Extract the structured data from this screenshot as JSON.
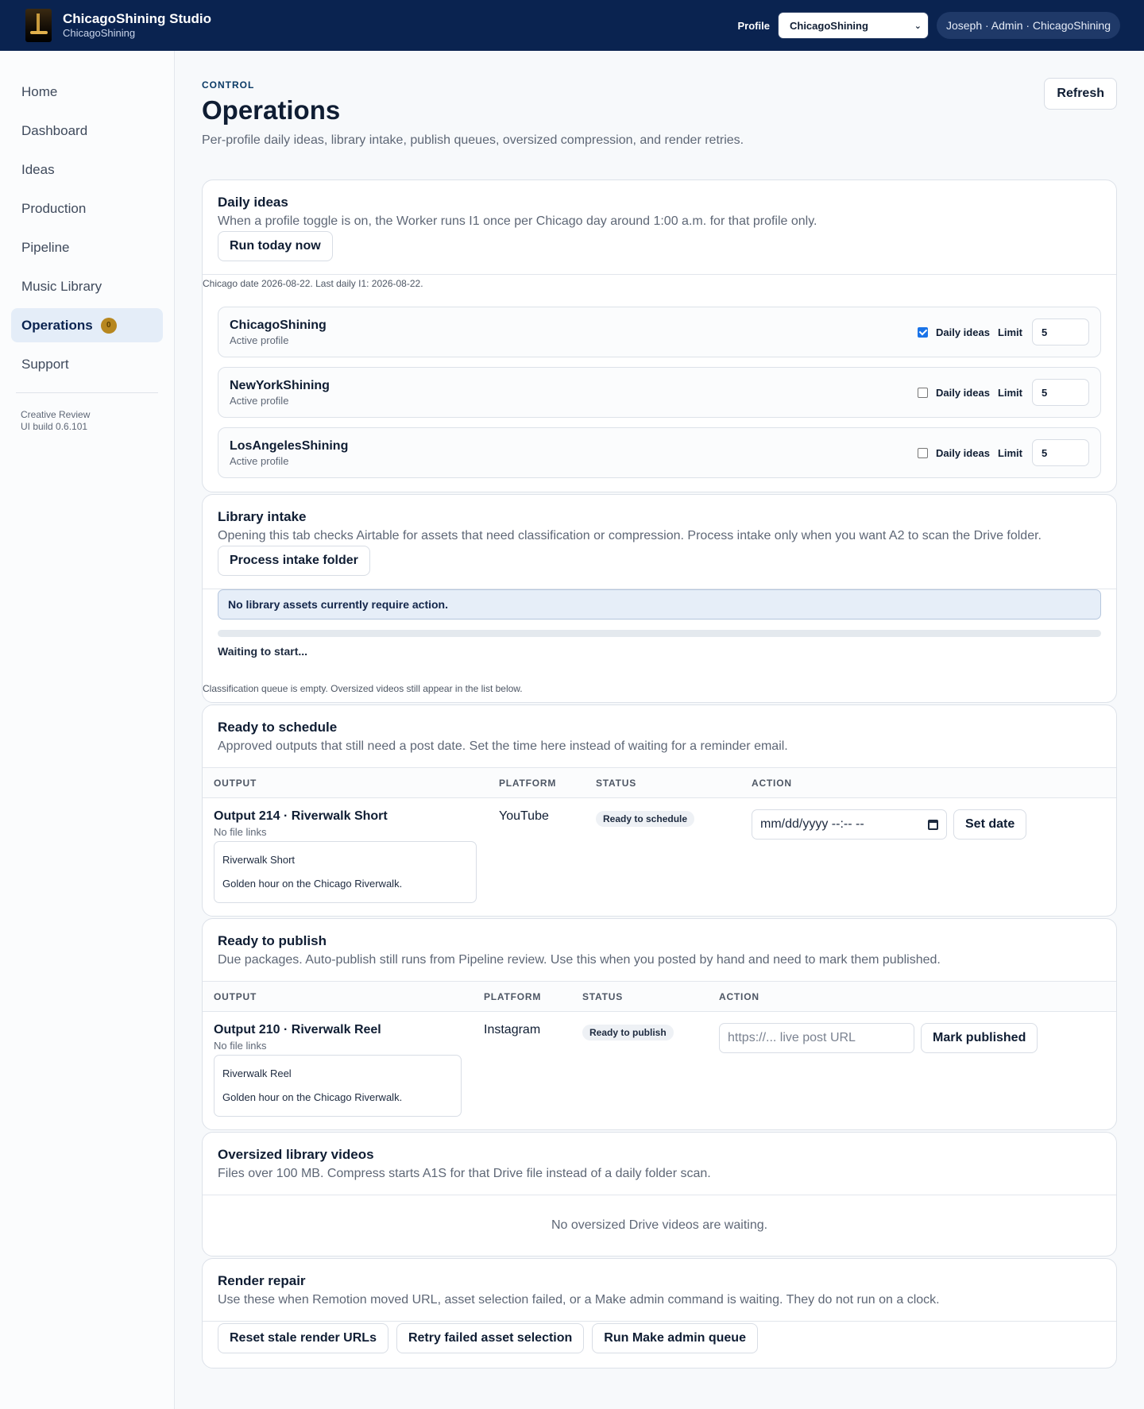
{
  "app": {
    "name": "ChicagoShining Studio",
    "sub": "ChicagoShining",
    "profile_label": "Profile",
    "profile_selected": "ChicagoShining",
    "user": "Joseph · Admin · ChicagoShining"
  },
  "sidebar": {
    "items": [
      {
        "label": "Home"
      },
      {
        "label": "Dashboard"
      },
      {
        "label": "Ideas"
      },
      {
        "label": "Production"
      },
      {
        "label": "Pipeline"
      },
      {
        "label": "Music Library"
      },
      {
        "label": "Operations",
        "badge": "0"
      },
      {
        "label": "Support"
      }
    ],
    "build_line1": "Creative Review",
    "build_line2": "UI build 0.6.101"
  },
  "page": {
    "eyebrow": "CONTROL",
    "title": "Operations",
    "desc": "Per-profile daily ideas, library intake, publish queues, oversized compression, and render retries.",
    "refresh": "Refresh"
  },
  "daily": {
    "title": "Daily ideas",
    "desc": "When a profile toggle is on, the Worker runs I1 once per Chicago day around 1:00 a.m. for that profile only.",
    "button": "Run today now",
    "note": "Chicago date 2026-08-22. Last daily I1: 2026-08-22.",
    "toggle_label": "Daily ideas",
    "limit_label": "Limit",
    "profiles": [
      {
        "name": "ChicagoShining",
        "status": "Active profile",
        "enabled": true,
        "limit": "5"
      },
      {
        "name": "NewYorkShining",
        "status": "Active profile",
        "enabled": false,
        "limit": "5"
      },
      {
        "name": "LosAngelesShining",
        "status": "Active profile",
        "enabled": false,
        "limit": "5"
      }
    ]
  },
  "intake": {
    "title": "Library intake",
    "desc": "Opening this tab checks Airtable for assets that need classification or compression. Process intake only when you want A2 to scan the Drive folder.",
    "button": "Process intake folder",
    "info": "No library assets currently require action.",
    "progress": 0,
    "progress_text": "Waiting to start...",
    "note": "Classification queue is empty. Oversized videos still appear in the list below."
  },
  "schedule": {
    "title": "Ready to schedule",
    "desc": "Approved outputs that still need a post date. Set the time here instead of waiting for a reminder email.",
    "columns": [
      "OUTPUT",
      "PLATFORM",
      "STATUS",
      "ACTION"
    ],
    "row": {
      "title": "Output 214 · Riverwalk Short",
      "sub": "No file links",
      "box_line1": "Riverwalk Short",
      "box_line2": "Golden hour on the Chicago Riverwalk.",
      "platform": "YouTube",
      "status": "Ready to schedule",
      "input_placeholder": "mm/dd/yyyy --:-- --",
      "button": "Set date"
    }
  },
  "publish": {
    "title": "Ready to publish",
    "desc": "Due packages. Auto-publish still runs from Pipeline review. Use this when you posted by hand and need to mark them published.",
    "columns": [
      "OUTPUT",
      "PLATFORM",
      "STATUS",
      "ACTION"
    ],
    "row": {
      "title": "Output 210 · Riverwalk Reel",
      "sub": "No file links",
      "box_line1": "Riverwalk Reel",
      "box_line2": "Golden hour on the Chicago Riverwalk.",
      "platform": "Instagram",
      "status": "Ready to publish",
      "input_placeholder": "https://... live post URL",
      "button": "Mark published"
    }
  },
  "oversized": {
    "title": "Oversized library videos",
    "desc": "Files over 100 MB. Compress starts A1S for that Drive file instead of a daily folder scan.",
    "empty": "No oversized Drive videos are waiting."
  },
  "render": {
    "title": "Render repair",
    "desc": "Use these when Remotion moved URL, asset selection failed, or a Make admin command is waiting. They do not run on a clock.",
    "buttons": [
      "Reset stale render URLs",
      "Retry failed asset selection",
      "Run Make admin queue"
    ]
  }
}
